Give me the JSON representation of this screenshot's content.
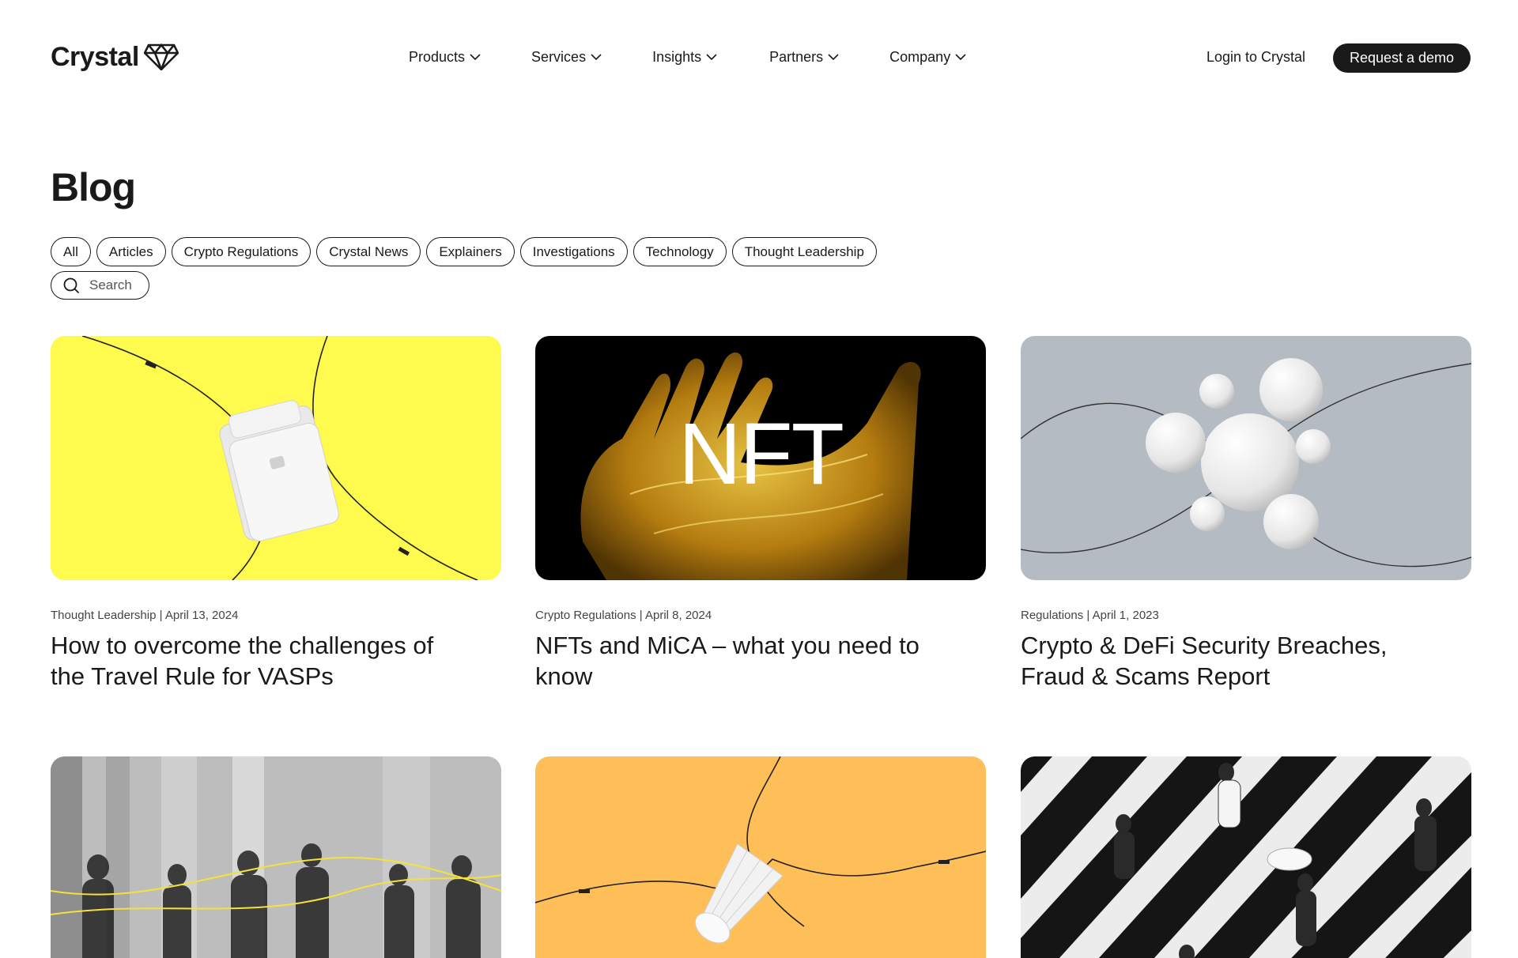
{
  "header": {
    "logo_text": "Crystal",
    "logo_icon": "diamond-icon",
    "nav": [
      {
        "label": "Products"
      },
      {
        "label": "Services"
      },
      {
        "label": "Insights"
      },
      {
        "label": "Partners"
      },
      {
        "label": "Company"
      }
    ],
    "login_label": "Login to Crystal",
    "demo_label": "Request a demo"
  },
  "page": {
    "title": "Blog"
  },
  "filters": [
    "All",
    "Articles",
    "Crypto Regulations",
    "Crystal News",
    "Explainers",
    "Investigations",
    "Technology",
    "Thought Leadership"
  ],
  "search": {
    "placeholder": "Search",
    "icon": "search-icon"
  },
  "posts": [
    {
      "category": "Thought Leadership",
      "date": "April 13, 2024",
      "meta_sep": " | ",
      "title": "How to overcome the challenges of the Travel Rule for VASPs",
      "bg": "#fefa4e"
    },
    {
      "category": "Crypto Regulations",
      "date": "April 8, 2024",
      "meta_sep": " | ",
      "title": "NFTs and MiCA – what you need to know",
      "bg": "#000000",
      "image_text": "NFT"
    },
    {
      "category": "Regulations",
      "date": "April 1, 2023",
      "meta_sep": " | ",
      "title": "Crypto & DeFi Security Breaches, Fraud & Scams Report",
      "bg": "#b5bbc3"
    },
    {
      "bg": "#8a8a8a"
    },
    {
      "bg": "#febe58"
    },
    {
      "bg": "#e8e8e8"
    }
  ]
}
